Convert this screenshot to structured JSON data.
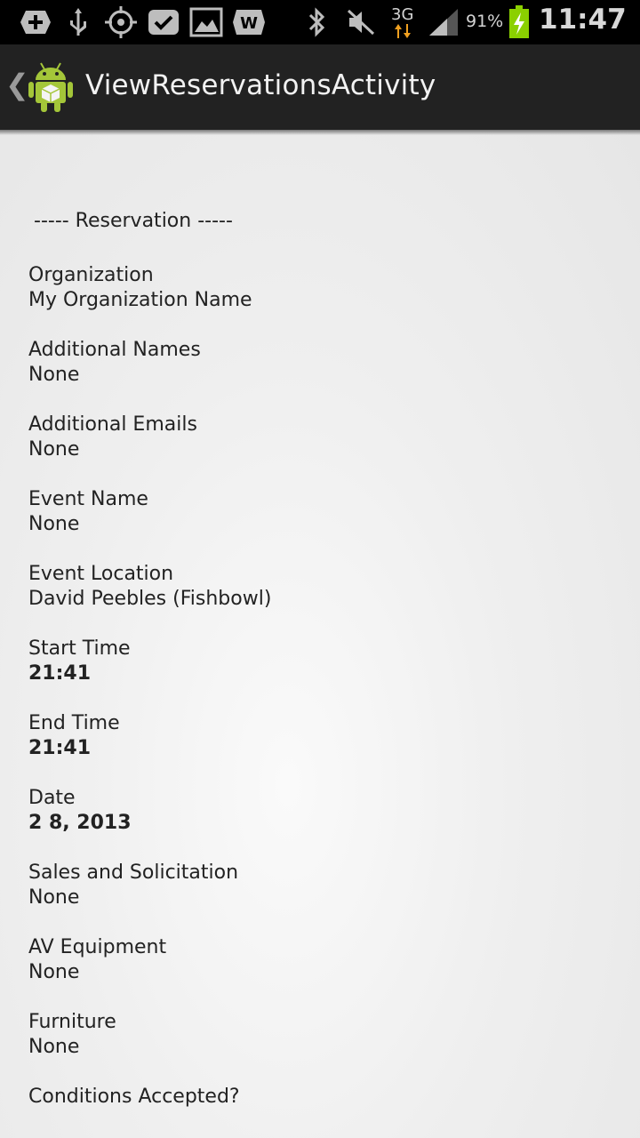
{
  "status_bar": {
    "network": "3G",
    "battery": "91%",
    "time": "11:47",
    "icons": [
      "add-icon",
      "usb-icon",
      "gps-icon",
      "check-icon",
      "gallery-icon",
      "w-app-icon",
      "bluetooth-icon",
      "mute-icon",
      "signal-icon",
      "battery-charging-icon"
    ]
  },
  "action_bar": {
    "title": "ViewReservationsActivity"
  },
  "content": {
    "header": "----- Reservation -----",
    "fields": [
      {
        "label": "Organization",
        "value": "My Organization Name"
      },
      {
        "label": "Additional Names",
        "value": "None"
      },
      {
        "label": "Additional Emails",
        "value": "None"
      },
      {
        "label": "Event Name",
        "value": "None"
      },
      {
        "label": "Event Location",
        "value": "David Peebles (Fishbowl)"
      },
      {
        "label": "Start Time",
        "value": "21:41"
      },
      {
        "label": "End Time",
        "value": "21:41"
      },
      {
        "label": "Date",
        "value": "2 8, 2013"
      },
      {
        "label": "Sales and Solicitation",
        "value": "None"
      },
      {
        "label": "AV Equipment",
        "value": "None"
      },
      {
        "label": "Furniture",
        "value": "None"
      },
      {
        "label": "Conditions Accepted?",
        "value": ""
      }
    ]
  },
  "colors": {
    "action_bar": "#222222",
    "content_bg": "#efefef",
    "android_green": "#a4c639",
    "battery_green": "#8bd000"
  }
}
